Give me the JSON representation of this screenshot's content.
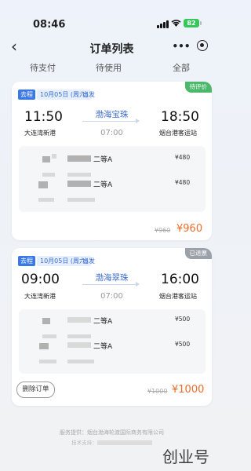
{
  "status_bar": {
    "time": "08:46",
    "battery": "82"
  },
  "nav": {
    "title": "订单列表"
  },
  "tabs": [
    {
      "label": "待支付"
    },
    {
      "label": "待使用"
    },
    {
      "label": "全部"
    }
  ],
  "orders": [
    {
      "direction": "去程",
      "date": "10月05日 (周六)",
      "depart_label": "出发",
      "status": "待评价",
      "depart_time": "11:50",
      "depart_port": "大连湾新港",
      "ship": "渤海宝珠",
      "duration": "07:00",
      "arrive_time": "18:50",
      "arrive_port": "烟台港客运站",
      "passengers": [
        {
          "seat": "二等A",
          "price": "¥480"
        },
        {
          "seat": "二等A",
          "price": "¥480"
        }
      ],
      "original_total": "¥960",
      "total": "¥960"
    },
    {
      "direction": "去程",
      "date": "10月05日 (周六)",
      "depart_label": "出发",
      "status": "已退票",
      "depart_time": "09:00",
      "depart_port": "大连湾新港",
      "ship": "渤海翠珠",
      "duration": "07:00",
      "arrive_time": "16:00",
      "arrive_port": "烟台港客运站",
      "passengers": [
        {
          "seat": "二等A",
          "price": "¥500"
        },
        {
          "seat": "二等A",
          "price": "¥500"
        }
      ],
      "original_total": "¥1000",
      "total": "¥1000",
      "delete_label": "删除订单"
    }
  ],
  "footer": {
    "provider": "服务提供：烟台渤海轮渡国际商务有限公司",
    "support": "技术支持："
  },
  "watermark": "创业号",
  "colors": {
    "accent": "#3b78e7",
    "price": "#ee6d2a",
    "tag_green": "#4cb86b",
    "tag_gray": "#9ba1a8"
  }
}
